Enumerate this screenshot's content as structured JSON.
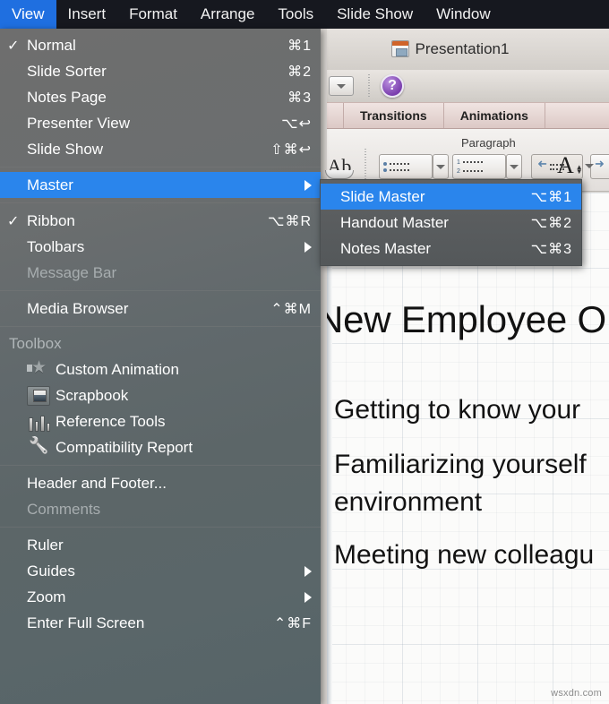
{
  "menubar": {
    "items": [
      {
        "label": "View",
        "active": true
      },
      {
        "label": "Insert",
        "active": false
      },
      {
        "label": "Format",
        "active": false
      },
      {
        "label": "Arrange",
        "active": false
      },
      {
        "label": "Tools",
        "active": false
      },
      {
        "label": "Slide Show",
        "active": false
      },
      {
        "label": "Window",
        "active": false
      }
    ]
  },
  "view_menu": {
    "groups": [
      {
        "items": [
          {
            "label": "Normal",
            "shortcut": "⌘1",
            "checked": true
          },
          {
            "label": "Slide Sorter",
            "shortcut": "⌘2",
            "checked": false
          },
          {
            "label": "Notes Page",
            "shortcut": "⌘3",
            "checked": false
          },
          {
            "label": "Presenter View",
            "shortcut": "⌥↩",
            "checked": false
          },
          {
            "label": "Slide Show",
            "shortcut": "⇧⌘↩",
            "checked": false
          }
        ]
      },
      {
        "items": [
          {
            "label": "Master",
            "shortcut": "",
            "checked": false,
            "submenu": true,
            "selected": true
          }
        ]
      },
      {
        "items": [
          {
            "label": "Ribbon",
            "shortcut": "⌥⌘R",
            "checked": true
          },
          {
            "label": "Toolbars",
            "shortcut": "",
            "checked": false,
            "submenu": true
          },
          {
            "label": "Message Bar",
            "shortcut": "",
            "checked": false,
            "disabled": true
          }
        ]
      },
      {
        "items": [
          {
            "label": "Media Browser",
            "shortcut": "⌃⌘M",
            "checked": false
          }
        ]
      },
      {
        "header": "Toolbox",
        "items": [
          {
            "label": "Custom Animation",
            "icon": "star-icon"
          },
          {
            "label": "Scrapbook",
            "icon": "scrapbook-icon"
          },
          {
            "label": "Reference Tools",
            "icon": "reference-tools-icon"
          },
          {
            "label": "Compatibility Report",
            "icon": "wrench-icon"
          }
        ]
      },
      {
        "items": [
          {
            "label": "Header and Footer...",
            "shortcut": "",
            "checked": false
          },
          {
            "label": "Comments",
            "shortcut": "",
            "checked": false,
            "disabled": true
          }
        ]
      },
      {
        "items": [
          {
            "label": "Ruler",
            "shortcut": "",
            "checked": false
          },
          {
            "label": "Guides",
            "shortcut": "",
            "checked": false,
            "submenu": true
          },
          {
            "label": "Zoom",
            "shortcut": "",
            "checked": false,
            "submenu": true
          },
          {
            "label": "Enter Full Screen",
            "shortcut": "⌃⌘F",
            "checked": false
          }
        ]
      }
    ]
  },
  "master_submenu": {
    "items": [
      {
        "label": "Slide Master",
        "shortcut": "⌥⌘1",
        "selected": true
      },
      {
        "label": "Handout Master",
        "shortcut": "⌥⌘2",
        "selected": false
      },
      {
        "label": "Notes Master",
        "shortcut": "⌥⌘3",
        "selected": false
      }
    ]
  },
  "ppt_window": {
    "title": "Presentation1",
    "doc_icon": "powerpoint-document-icon",
    "help_icon": "help-question-icon",
    "ribbon_tabs": [
      {
        "label": "Transitions"
      },
      {
        "label": "Animations"
      }
    ],
    "ribbon_group_label": "Paragraph",
    "text_effects_icon": "text-effects-ab-icon",
    "bullets_icon": "bulleted-list-icon",
    "numbering_icon": "numbered-list-icon",
    "decrease_indent_icon": "decrease-indent-icon",
    "increase_indent_icon": "increase-indent-icon",
    "line_spacing_icon": "line-spacing-icon",
    "font_size_icon": "font-size-icon",
    "qat_dropdown_icon": "chevron-down-icon"
  },
  "slide": {
    "title": "New Employee O",
    "body_lines": [
      "Getting to know your",
      "Familiarizing yourself",
      "environment",
      "Meeting new colleagu"
    ]
  },
  "watermark": "wsxdn.com",
  "colors": {
    "menubar_bg": "#16181f",
    "menubar_active": "#1f6fe0",
    "menu_highlight": "#2a85ec",
    "menu_bg": "#64696b",
    "ribbon_tab_bg": "#e8d8d5"
  }
}
